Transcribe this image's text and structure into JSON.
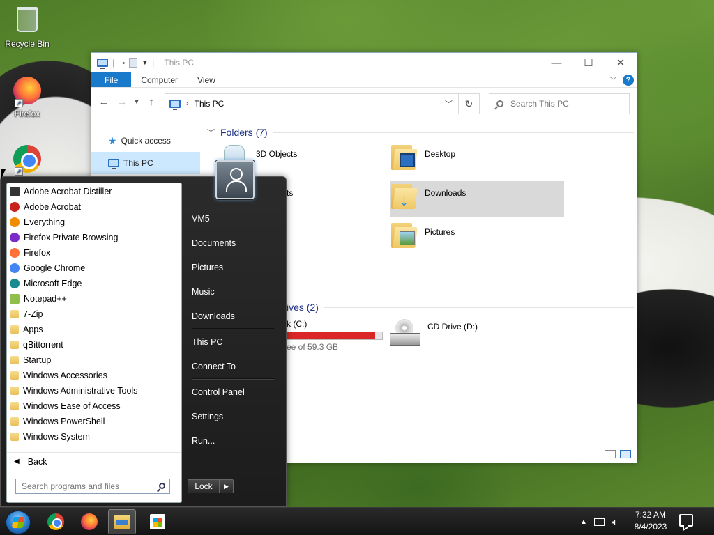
{
  "desktop": {
    "icons": [
      {
        "label": "Recycle Bin",
        "icon": "recycle-bin-icon"
      },
      {
        "label": "Firefox",
        "icon": "firefox-icon"
      },
      {
        "label": "",
        "icon": "chrome-icon"
      }
    ]
  },
  "explorer": {
    "title": "This PC",
    "ribbon_tabs": [
      "File",
      "Computer",
      "View"
    ],
    "address": "This PC",
    "search_placeholder": "Search This PC",
    "nav": {
      "quick_access": "Quick access",
      "this_pc": "This PC"
    },
    "folders_header": "Folders (7)",
    "folders": [
      "3D Objects",
      "Desktop",
      "Downloads",
      "Pictures"
    ],
    "folder_partial": "ts",
    "drives_header_partial": "ives (2)",
    "drive_c_partial": "k (C:)",
    "drive_c_free_partial": "ee of 59.3 GB",
    "drive_c_used_fraction": 0.93,
    "drive_d": "CD Drive (D:)",
    "accent_color": "#1979ca"
  },
  "start_menu": {
    "programs": [
      {
        "label": "Adobe Acrobat Distiller",
        "icon": "acrobat-distiller-icon",
        "color": "#333333"
      },
      {
        "label": "Adobe Acrobat",
        "icon": "acrobat-icon",
        "color": "#c8201c"
      },
      {
        "label": "Everything",
        "icon": "everything-search-icon",
        "color": "#f08c00"
      },
      {
        "label": "Firefox Private Browsing",
        "icon": "firefox-private-icon",
        "color": "#7b2cc7"
      },
      {
        "label": "Firefox",
        "icon": "firefox-icon",
        "color": "#ff7139"
      },
      {
        "label": "Google Chrome",
        "icon": "chrome-icon",
        "color": "#4285f4"
      },
      {
        "label": "Microsoft Edge",
        "icon": "edge-icon",
        "color": "#1a8a8f"
      },
      {
        "label": "Notepad++",
        "icon": "notepad-plus-plus-icon",
        "color": "#8fbf4a"
      },
      {
        "label": "7-Zip",
        "icon": "folder-icon",
        "color": "#e8bf5a"
      },
      {
        "label": "Apps",
        "icon": "folder-icon",
        "color": "#e8bf5a"
      },
      {
        "label": "qBittorrent",
        "icon": "folder-icon",
        "color": "#e8bf5a"
      },
      {
        "label": "Startup",
        "icon": "folder-icon",
        "color": "#e8bf5a"
      },
      {
        "label": "Windows Accessories",
        "icon": "folder-icon",
        "color": "#e8bf5a"
      },
      {
        "label": "Windows Administrative Tools",
        "icon": "folder-icon",
        "color": "#e8bf5a"
      },
      {
        "label": "Windows Ease of Access",
        "icon": "folder-icon",
        "color": "#e8bf5a"
      },
      {
        "label": "Windows PowerShell",
        "icon": "folder-icon",
        "color": "#e8bf5a"
      },
      {
        "label": "Windows System",
        "icon": "folder-icon",
        "color": "#e8bf5a"
      }
    ],
    "back_label": "Back",
    "search_placeholder": "Search programs and files",
    "right_items": [
      {
        "label": "VM5",
        "sep_after": false
      },
      {
        "label": "Documents",
        "sep_after": false
      },
      {
        "label": "Pictures",
        "sep_after": false
      },
      {
        "label": "Music",
        "sep_after": false
      },
      {
        "label": "Downloads",
        "sep_after": true
      },
      {
        "label": "This PC",
        "sep_after": false
      },
      {
        "label": "Connect To",
        "sep_after": true
      },
      {
        "label": "Control Panel",
        "sep_after": false
      },
      {
        "label": "Settings",
        "sep_after": false
      },
      {
        "label": "Run...",
        "sep_after": false
      }
    ],
    "lock_label": "Lock"
  },
  "taskbar": {
    "time": "7:32 AM",
    "date": "8/4/2023"
  }
}
